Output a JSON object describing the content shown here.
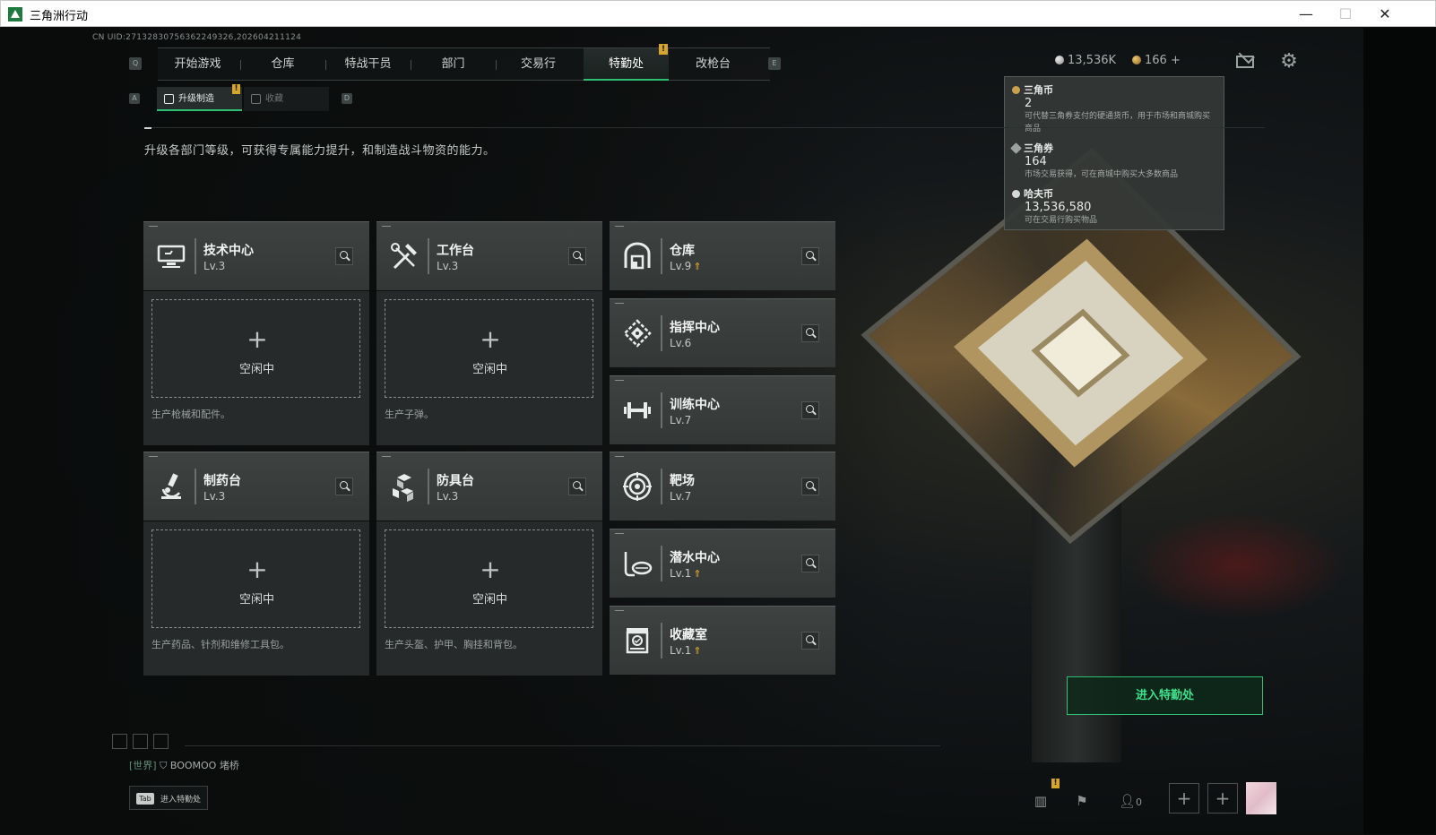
{
  "window": {
    "title": "三角洲行动",
    "minimize": "—",
    "maximize": "☐",
    "close": "✕"
  },
  "uid": "CN UID:2713283075636224932​6,202604211124",
  "nav": {
    "left_key": "Q",
    "right_key": "E",
    "tabs": [
      "开始游戏",
      "仓库",
      "特战干员",
      "部门",
      "交易行",
      "特勤处",
      "改枪台"
    ],
    "active": "特勤处",
    "badge": "!"
  },
  "subtabs": {
    "left_key": "A",
    "right_key": "D",
    "items": [
      "升级制造",
      "收藏"
    ],
    "active": "升级制造",
    "badge": "!"
  },
  "currency": {
    "silver": "13,536K",
    "gold": "166",
    "gold_add": "+"
  },
  "tooltip": {
    "items": [
      {
        "name": "三角币",
        "value": "2",
        "desc": "可代替三角券支付的硬通货币，用于市场和商城购买商品",
        "color": "#c8a050"
      },
      {
        "name": "三角券",
        "value": "164",
        "desc": "市场交易获得，可在商城中购买大多数商品",
        "color": "#9aa3a0"
      },
      {
        "name": "哈夫币",
        "value": "13,536,580",
        "desc": "可在交易行购买物品",
        "color": "#d8d8d8"
      }
    ]
  },
  "description": "升级各部门等级，可获得专属能力提升，和制造战斗物资的能力。",
  "departments_left": [
    {
      "name": "技术中心",
      "level": "Lv.3",
      "icon": "monitor-icon",
      "idle": "空闲中",
      "caption": "生产枪械和配件。"
    },
    {
      "name": "工作台",
      "level": "Lv.3",
      "icon": "tools-icon",
      "idle": "空闲中",
      "caption": "生产子弹。"
    },
    {
      "name": "制药台",
      "level": "Lv.3",
      "icon": "microscope-icon",
      "idle": "空闲中",
      "caption": "生产药品、针剂和维修工具包。"
    },
    {
      "name": "防具台",
      "level": "Lv.3",
      "icon": "cubes-icon",
      "idle": "空闲中",
      "caption": "生产头盔、护甲、胸挂和背包。"
    }
  ],
  "departments_right": [
    {
      "name": "仓库",
      "level": "Lv.9",
      "upgrade": "⇑",
      "icon": "warehouse-icon"
    },
    {
      "name": "指挥中心",
      "level": "Lv.6",
      "upgrade": "",
      "icon": "command-icon"
    },
    {
      "name": "训练中心",
      "level": "Lv.7",
      "upgrade": "",
      "icon": "dumbbell-icon"
    },
    {
      "name": "靶场",
      "level": "Lv.7",
      "upgrade": "",
      "icon": "target-icon"
    },
    {
      "name": "潜水中心",
      "level": "Lv.1",
      "upgrade": "⇑",
      "icon": "diving-icon"
    },
    {
      "name": "收藏室",
      "level": "Lv.1",
      "upgrade": "⇑",
      "icon": "trophy-icon"
    }
  ],
  "enter_button": "进入特勤处",
  "chat": {
    "channel": "[世界]",
    "user": "BOOMOO",
    "message": "堵桥"
  },
  "tab_hint": {
    "key": "Tab",
    "label": "进入特勤处"
  },
  "bottom": {
    "friends_count": "0",
    "plus": "+",
    "badge": "!"
  }
}
